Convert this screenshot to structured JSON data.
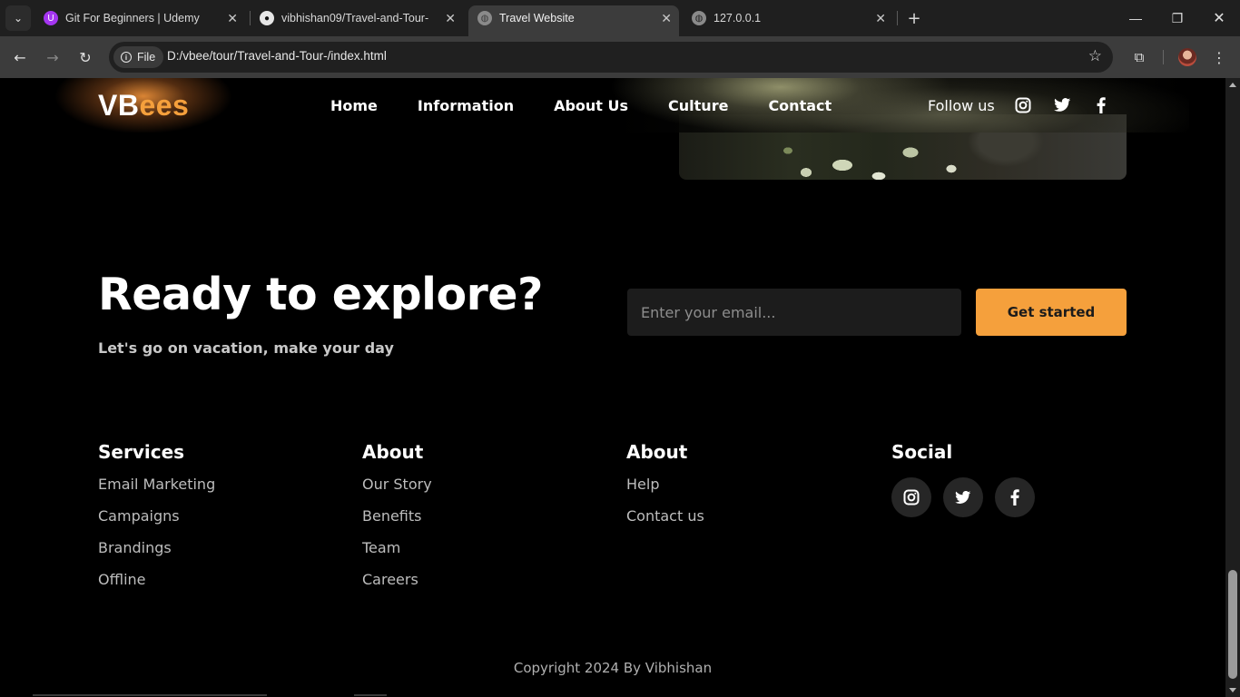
{
  "browser": {
    "tabs": [
      {
        "title": "Git For Beginners | Udemy",
        "active": false
      },
      {
        "title": "vibhishan09/Travel-and-Tour-",
        "active": false
      },
      {
        "title": "Travel Website",
        "active": true
      },
      {
        "title": "127.0.0.1",
        "active": false
      }
    ],
    "chip_label": "File",
    "url": "D:/vbee/tour/Travel-and-Tour-/index.html"
  },
  "nav": {
    "logo_part1": "VB",
    "logo_part2": "ees",
    "links": [
      "Home",
      "Information",
      "About Us",
      "Culture",
      "Contact"
    ],
    "follow_label": "Follow us"
  },
  "cta": {
    "title": "Ready to explore?",
    "subtitle": "Let's go on vacation, make your day",
    "email_placeholder": "Enter your email...",
    "button_label": "Get started"
  },
  "footer": {
    "columns": [
      {
        "heading": "Services",
        "links": [
          "Email Marketing",
          "Campaigns",
          "Brandings",
          "Offline"
        ]
      },
      {
        "heading": "About",
        "links": [
          "Our Story",
          "Benefits",
          "Team",
          "Careers"
        ]
      },
      {
        "heading": "About",
        "links": [
          "Help",
          "Contact us"
        ]
      }
    ],
    "social_heading": "Social",
    "copyright": "Copyright 2024 By Vibhishan"
  },
  "colors": {
    "accent": "#f5a03c",
    "background": "#000000",
    "input_bg": "#1c1c1c"
  }
}
